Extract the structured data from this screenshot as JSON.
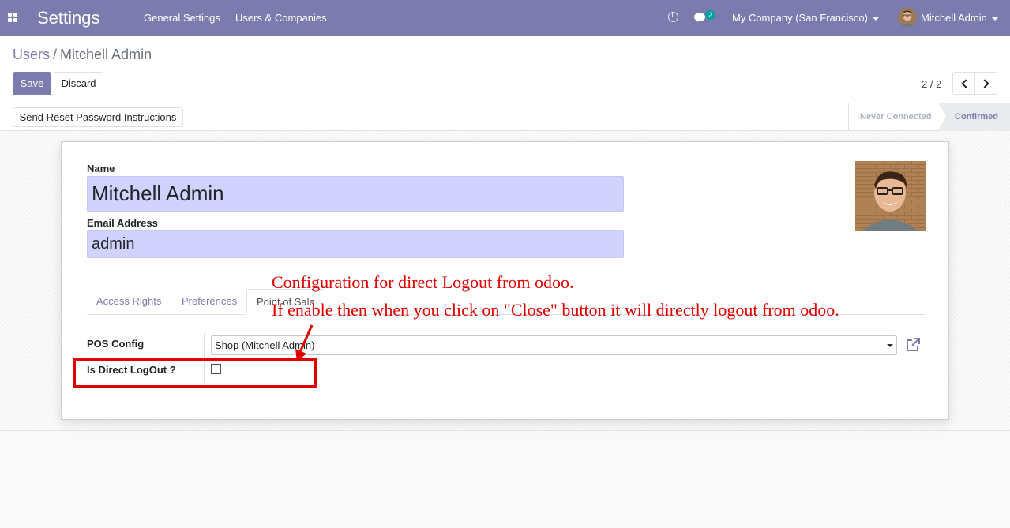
{
  "navbar": {
    "app_title": "Settings",
    "menu": [
      "General Settings",
      "Users & Companies"
    ],
    "chat_count": "2",
    "company": "My Company (San Francisco)",
    "user": "Mitchell Admin"
  },
  "breadcrumb": {
    "parent": "Users",
    "separator": "/",
    "current": "Mitchell Admin"
  },
  "actions": {
    "save_label": "Save",
    "discard_label": "Discard"
  },
  "pager": {
    "value": "2 / 2"
  },
  "statusbar": {
    "reset_button": "Send Reset Password Instructions",
    "steps": [
      "Never Connected",
      "Confirmed"
    ],
    "active_step": "Confirmed"
  },
  "form": {
    "name_label": "Name",
    "name_value": "Mitchell Admin",
    "email_label": "Email Address",
    "email_value": "admin",
    "tabs": [
      "Access Rights",
      "Preferences",
      "Point of Sale"
    ],
    "active_tab": "Point of Sale",
    "pos_config_label": "POS Config",
    "pos_config_value": "Shop (Mitchell Admin)",
    "direct_logout_label": "Is Direct LogOut ?",
    "direct_logout_checked": false
  },
  "annotation": {
    "line1": "Configuration for direct Logout from odoo.",
    "line2": "If enable then when you click on \"Close\" button it will directly logout from odoo.",
    "color": "#e00000"
  },
  "colors": {
    "brand": "#7c7bad",
    "input_highlight": "#d2d2ff"
  }
}
